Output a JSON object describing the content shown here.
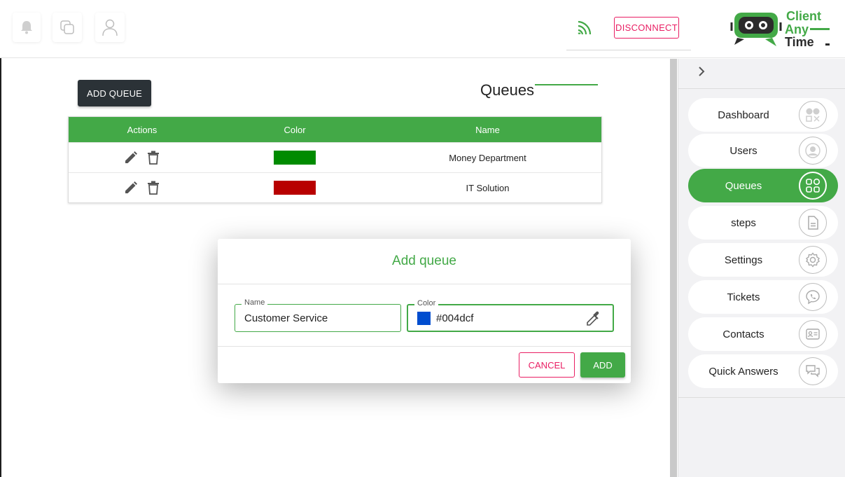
{
  "topbar": {
    "icons": [
      "bell-icon",
      "copy-icon",
      "user-icon"
    ],
    "disconnect_label": "DISCONNECT",
    "logo_lines": [
      "Client",
      "Any",
      "Time"
    ]
  },
  "main": {
    "add_queue_label": "ADD QUEUE",
    "page_title": "Queues",
    "table": {
      "headers": {
        "actions": "Actions",
        "color": "Color",
        "name": "Name"
      },
      "rows": [
        {
          "color": "#008b00",
          "name": "Money Department"
        },
        {
          "color": "#b80000",
          "name": "IT Solution"
        }
      ]
    }
  },
  "dialog": {
    "title": "Add queue",
    "name_label": "Name",
    "name_value": "Customer Service",
    "color_label": "Color",
    "color_value": "#004dcf",
    "cancel_label": "CANCEL",
    "add_label": "ADD"
  },
  "sidebar": {
    "items": [
      {
        "label": "Dashboard",
        "icon": "dashboard-icon"
      },
      {
        "label": "Users",
        "icon": "user-icon"
      },
      {
        "label": "Queues",
        "icon": "queues-icon",
        "active": true
      },
      {
        "label": "steps",
        "icon": "document-icon"
      },
      {
        "label": "Settings",
        "icon": "gear-icon"
      },
      {
        "label": "Tickets",
        "icon": "ticket-icon"
      },
      {
        "label": "Contacts",
        "icon": "contact-card-icon"
      },
      {
        "label": "Quick Answers",
        "icon": "chat-icon"
      }
    ]
  },
  "colors": {
    "brand_green": "#43a947",
    "accent_pink": "#e91e63",
    "dark_button": "#2b3237"
  }
}
